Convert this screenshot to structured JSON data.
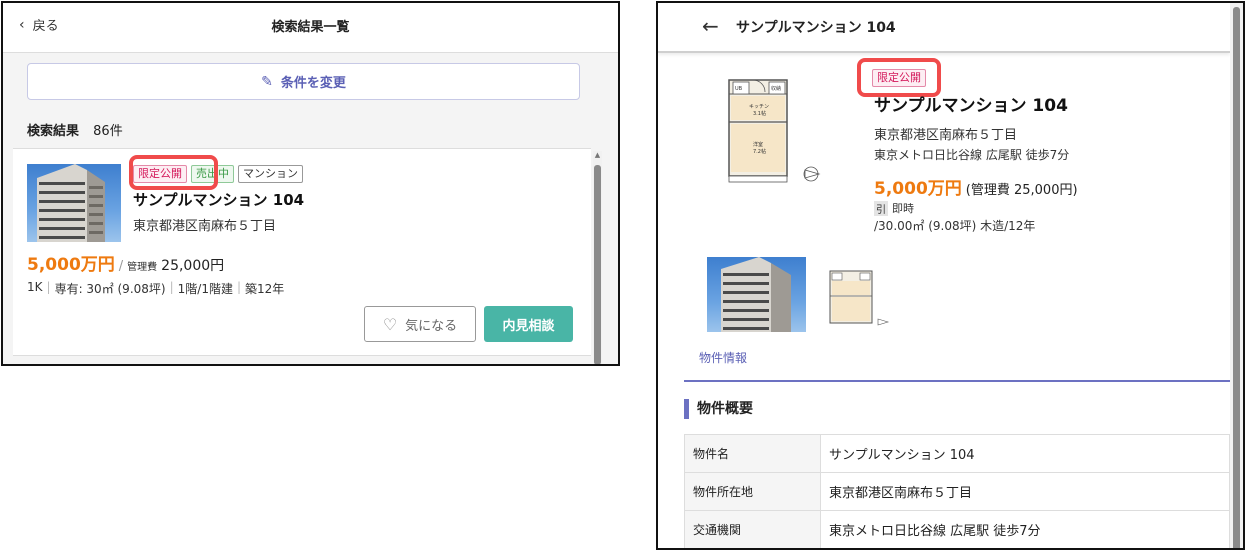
{
  "left": {
    "back_label": "戻る",
    "title": "検索結果一覧",
    "change_conditions_label": "条件を変更",
    "result_label": "検索結果",
    "result_count": "86件",
    "card": {
      "badges": [
        "限定公開",
        "売出中",
        "マンション"
      ],
      "name": "サンプルマンション 104",
      "address": "東京都港区南麻布５丁目",
      "price": "5,000万円",
      "price_sep": "/",
      "fee_label": "管理費",
      "fee": "25,000円",
      "specs": [
        "1K",
        "専有: 30㎡ (9.08坪)",
        "1階/1階建",
        "築12年"
      ],
      "fav_label": "気になる",
      "visit_label": "内見相談"
    }
  },
  "right": {
    "title": "サンプルマンション 104",
    "badge": "限定公開",
    "name": "サンプルマンション 104",
    "address": "東京都港区南麻布５丁目",
    "access": "東京メトロ日比谷線 広尾駅 徒歩7分",
    "price": "5,000万円",
    "fee_text": "(管理費 25,000円)",
    "move_tag": "引",
    "move_text": "即時",
    "size_text": "/30.00㎡ (9.08坪)  木造/12年",
    "tab_label": "物件情報",
    "section_title": "物件概要",
    "table": [
      {
        "label": "物件名",
        "value": "サンプルマンション 104"
      },
      {
        "label": "物件所在地",
        "value": "東京都港区南麻布５丁目"
      },
      {
        "label": "交通機関",
        "value": "東京メトロ日比谷線 広尾駅 徒歩7分"
      }
    ],
    "floorplan_labels": {
      "kitchen": "キッチン",
      "kitchen_size": "3.1帖",
      "room": "洋室",
      "room_size": "7.2帖",
      "bath": "UB",
      "closet": "収納"
    }
  },
  "colors": {
    "accent": "#5b60b5",
    "price": "#ee7a10",
    "highlight": "#f04b4b",
    "visit_button": "#49b5a6",
    "limited_badge": "#d4195b"
  }
}
